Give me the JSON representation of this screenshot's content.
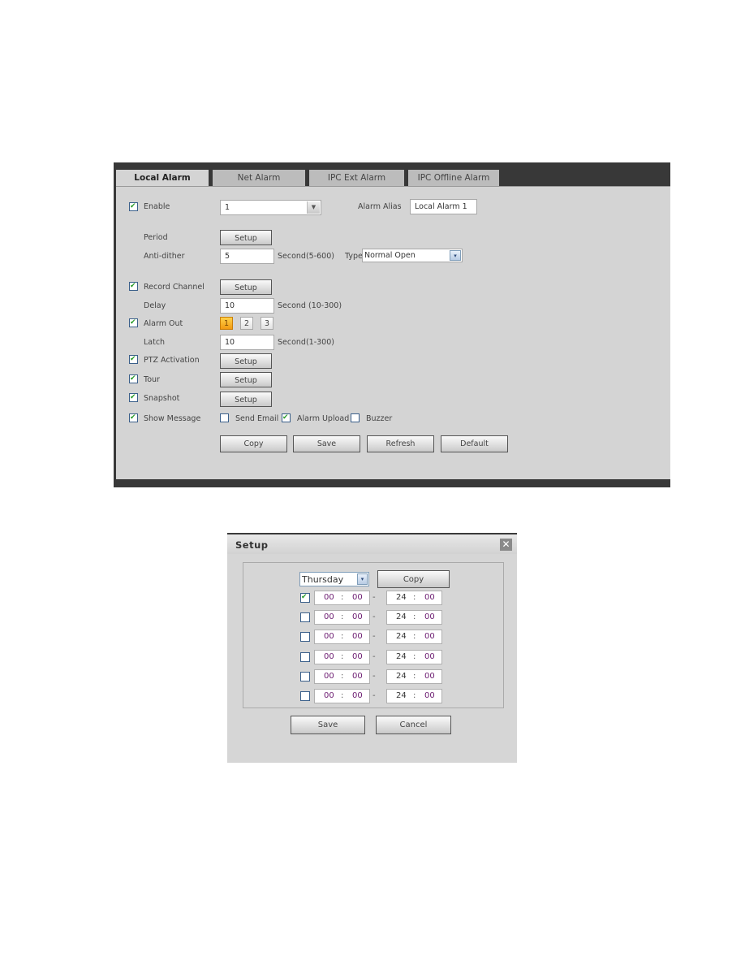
{
  "tabs": [
    {
      "label": "Local Alarm",
      "active": true
    },
    {
      "label": "Net Alarm",
      "active": false
    },
    {
      "label": "IPC Ext Alarm",
      "active": false
    },
    {
      "label": "IPC Offline Alarm",
      "active": false
    }
  ],
  "form": {
    "enable": {
      "label": "Enable",
      "checked": true,
      "value": "1"
    },
    "alarm_alias": {
      "label": "Alarm Alias",
      "value": "Local Alarm 1"
    },
    "period": {
      "label": "Period",
      "button": "Setup"
    },
    "anti_dither": {
      "label": "Anti-dither",
      "value": "5",
      "hint": "Second(5-600)"
    },
    "type": {
      "label": "Type",
      "value": "Normal Open"
    },
    "record_channel": {
      "label": "Record Channel",
      "checked": true,
      "button": "Setup"
    },
    "delay": {
      "label": "Delay",
      "value": "10",
      "hint": "Second (10-300)"
    },
    "alarm_out": {
      "label": "Alarm Out",
      "checked": true,
      "channels": [
        "1",
        "2",
        "3"
      ],
      "selected": "1"
    },
    "latch": {
      "label": "Latch",
      "value": "10",
      "hint": "Second(1-300)"
    },
    "ptz_activation": {
      "label": "PTZ Activation",
      "checked": true,
      "button": "Setup"
    },
    "tour": {
      "label": "Tour",
      "checked": true,
      "button": "Setup"
    },
    "snapshot": {
      "label": "Snapshot",
      "checked": true,
      "button": "Setup"
    },
    "show_message": {
      "label": "Show Message",
      "checked": true
    },
    "send_email": {
      "label": "Send Email",
      "checked": false
    },
    "alarm_upload": {
      "label": "Alarm Upload",
      "checked": true
    },
    "buzzer": {
      "label": "Buzzer",
      "checked": false
    }
  },
  "actions": {
    "copy": "Copy",
    "save": "Save",
    "refresh": "Refresh",
    "default": "Default"
  },
  "modal": {
    "title": "Setup",
    "close_icon": "close-icon",
    "day": "Thursday",
    "copy_label": "Copy",
    "periods": [
      {
        "enabled": true,
        "start_h": "00",
        "start_m": "00",
        "end_h": "24",
        "end_m": "00"
      },
      {
        "enabled": false,
        "start_h": "00",
        "start_m": "00",
        "end_h": "24",
        "end_m": "00"
      },
      {
        "enabled": false,
        "start_h": "00",
        "start_m": "00",
        "end_h": "24",
        "end_m": "00"
      },
      {
        "enabled": false,
        "start_h": "00",
        "start_m": "00",
        "end_h": "24",
        "end_m": "00"
      },
      {
        "enabled": false,
        "start_h": "00",
        "start_m": "00",
        "end_h": "24",
        "end_m": "00"
      },
      {
        "enabled": false,
        "start_h": "00",
        "start_m": "00",
        "end_h": "24",
        "end_m": "00"
      }
    ],
    "save_label": "Save",
    "cancel_label": "Cancel",
    "separator": ":",
    "dash": "-"
  }
}
